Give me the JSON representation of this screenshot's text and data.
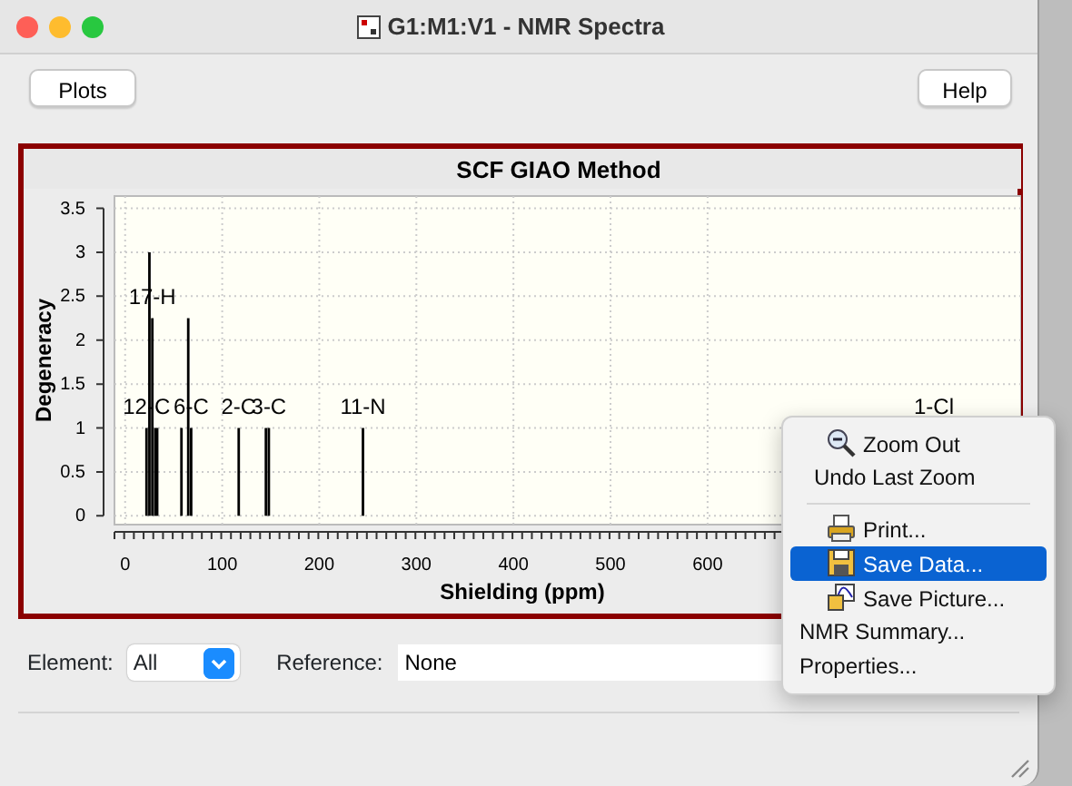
{
  "window": {
    "title": "G1:M1:V1 - NMR Spectra"
  },
  "toolbar": {
    "left_button": "Plots",
    "right_button": "Help"
  },
  "plot": {
    "chart_data": {
      "type": "bar",
      "title": "SCF GIAO Method",
      "xlabel": "Shielding (ppm)",
      "ylabel": "Degeneracy",
      "x": [
        22,
        25,
        28,
        31,
        33,
        58,
        65,
        68,
        117,
        145,
        148,
        245
      ],
      "values": [
        1,
        3,
        2.25,
        1,
        1,
        1,
        2.25,
        1,
        1,
        1,
        1,
        1
      ],
      "xlim": [
        -11,
        923
      ],
      "ylim": [
        -0.1,
        3.64
      ],
      "grid": true,
      "xticks": [
        0,
        100,
        200,
        300,
        400,
        500,
        600
      ],
      "yticks": [
        0,
        0.5,
        1,
        1.5,
        2,
        2.5,
        3,
        3.5
      ],
      "annotations": [
        {
          "text": "17-H",
          "x": 28,
          "y": 2.25
        },
        {
          "text": "12-C",
          "x": 22,
          "y": 1
        },
        {
          "text": "6-C",
          "x": 68,
          "y": 1
        },
        {
          "text": "2-C",
          "x": 117,
          "y": 1
        },
        {
          "text": "3-C",
          "x": 148,
          "y": 1
        },
        {
          "text": "11-N",
          "x": 245,
          "y": 1
        },
        "1-Cl"
      ]
    }
  },
  "controls": {
    "element_label": "Element:",
    "element_value": "All",
    "reference_label": "Reference:",
    "reference_value": "None"
  },
  "context_menu": [
    {
      "kind": "item",
      "label": "Zoom Out",
      "selected": false
    },
    {
      "kind": "item",
      "label": "Undo Last Zoom",
      "selected": false
    },
    {
      "kind": "separator"
    },
    {
      "kind": "item",
      "label": "Print...",
      "selected": false
    },
    {
      "kind": "item",
      "label": "Save Data...",
      "selected": true
    },
    {
      "kind": "item",
      "label": "Save Picture...",
      "selected": false
    },
    {
      "kind": "item",
      "label": "NMR Summary...",
      "selected": false
    },
    {
      "kind": "item",
      "label": "Properties...",
      "selected": false
    }
  ]
}
